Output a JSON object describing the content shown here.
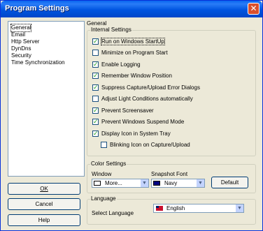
{
  "window": {
    "title": "Program Settings"
  },
  "tree": {
    "items": [
      {
        "label": "General"
      },
      {
        "label": "Email"
      },
      {
        "label": "Http Server"
      },
      {
        "label": "DynDns"
      },
      {
        "label": "Security"
      },
      {
        "label": "Time Synchronization"
      }
    ]
  },
  "buttons": {
    "ok": "OK",
    "cancel": "Cancel",
    "help": "Help",
    "default": "Default"
  },
  "general": {
    "label": "General",
    "internal_settings": {
      "title": "Internal Settings",
      "options": [
        {
          "label": "Run on Windows StartUp",
          "checked": true
        },
        {
          "label": "Minimize on Program Start",
          "checked": false
        },
        {
          "label": "Enable Logging",
          "checked": true
        },
        {
          "label": "Remember Window Position",
          "checked": true
        },
        {
          "label": "Suppress Capture/Upload Error Dialogs",
          "checked": true
        },
        {
          "label": "Adjust Light Conditions automatically",
          "checked": false
        },
        {
          "label": "Prevent Screensaver",
          "checked": true
        },
        {
          "label": "Prevent Windows Suspend Mode",
          "checked": true
        },
        {
          "label": "Display Icon in System Tray",
          "checked": true
        },
        {
          "label": "Blinking Icon on Capture/Upload",
          "checked": false
        }
      ]
    },
    "color_settings": {
      "title": "Color Settings",
      "window_label": "Window",
      "window_value": "More...",
      "window_color": "#ffffff",
      "snapshot_label": "Snapshot Font",
      "snapshot_value": "Navy",
      "snapshot_color": "#000080"
    },
    "language": {
      "title": "Language",
      "select_label": "Select Language",
      "value": "English"
    }
  }
}
